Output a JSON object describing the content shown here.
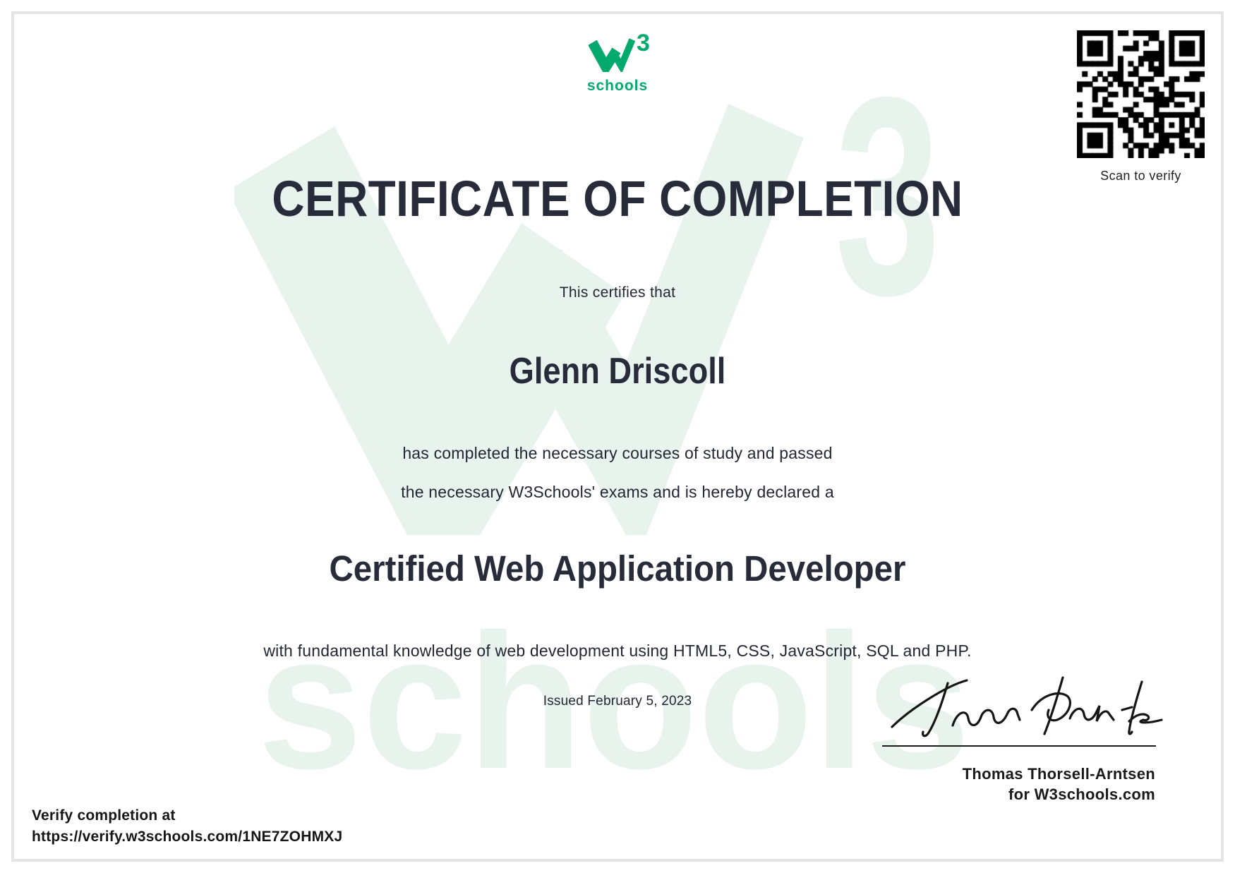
{
  "logo": {
    "mark": "W",
    "superscript": "3",
    "word": "schools"
  },
  "qr": {
    "caption": "Scan to verify"
  },
  "certificate": {
    "title": "CERTIFICATE OF COMPLETION",
    "intro": "This certifies that",
    "recipient": "Glenn Driscoll",
    "body_line1": "has completed the necessary courses of study and passed",
    "body_line2": "the necessary W3Schools' exams and is hereby declared a",
    "credential": "Certified Web Application Developer",
    "detail": "with fundamental knowledge of web development using HTML5, CSS, JavaScript, SQL and PHP.",
    "issued": "Issued February 5, 2023"
  },
  "signature": {
    "signer": "Thomas Thorsell-Arntsen",
    "org": "for W3schools.com"
  },
  "verify": {
    "label": "Verify completion at",
    "url": "https://verify.w3schools.com/1NE7ZOHMXJ"
  },
  "watermark": {
    "mark": "W",
    "superscript": "3",
    "word": "schools"
  },
  "colors": {
    "brand_green": "#04AA6D",
    "watermark_green": "#e9f3ee",
    "ink": "#282c3a",
    "text": "#222733"
  }
}
